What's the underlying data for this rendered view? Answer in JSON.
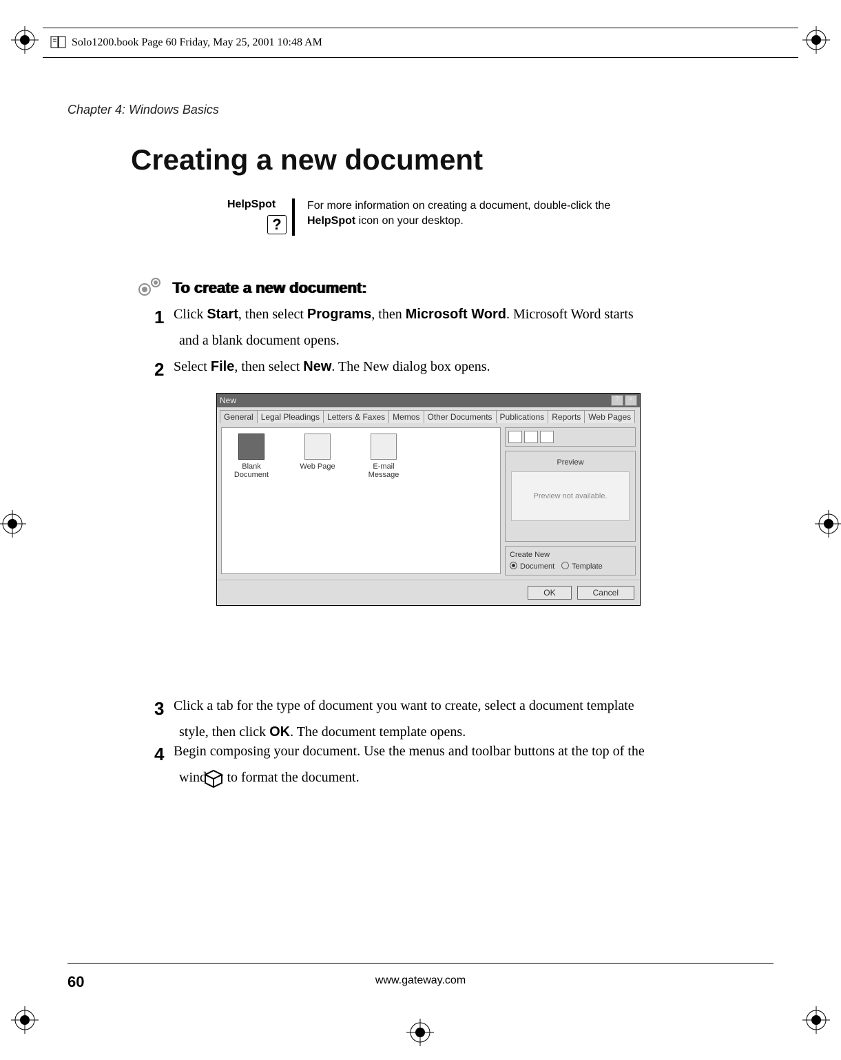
{
  "header_line": "Solo1200.book  Page 60  Friday, May 25, 2001  10:48 AM",
  "chapter": "Chapter 4: Windows Basics",
  "heading": "Creating a new document",
  "helpspot": {
    "label": "HelpSpot",
    "text_before": "For more information on creating a document, double-click the ",
    "bold": "HelpSpot",
    "text_after": " icon on your desktop."
  },
  "subheading": "To create a new document:",
  "steps": [
    {
      "num": "1",
      "parts": [
        {
          "t": "Click ",
          "b": false
        },
        {
          "t": "Start",
          "b": true
        },
        {
          "t": ", then select ",
          "b": false
        },
        {
          "t": "Programs",
          "b": true
        },
        {
          "t": ", then ",
          "b": false
        },
        {
          "t": "Microsoft Word",
          "b": true
        },
        {
          "t": ". Microsoft Word starts and a blank document opens.",
          "b": false
        }
      ]
    },
    {
      "num": "2",
      "parts": [
        {
          "t": "Select ",
          "b": false
        },
        {
          "t": "File",
          "b": true
        },
        {
          "t": ", then select ",
          "b": false
        },
        {
          "t": "New",
          "b": true
        },
        {
          "t": ". The New dialog box opens.",
          "b": false
        }
      ]
    },
    {
      "num": "3",
      "parts": [
        {
          "t": "Click a tab for the type of document you want to create, select a document template style, then click ",
          "b": false
        },
        {
          "t": "OK",
          "b": true
        },
        {
          "t": ". The document template opens.",
          "b": false
        }
      ]
    },
    {
      "num": "4",
      "parts": [
        {
          "t": "Begin composing your document. Use the menus and toolbar buttons at the top of the window to format the document.",
          "b": false
        }
      ]
    }
  ],
  "dialog": {
    "title": "New",
    "tabs": [
      "General",
      "Legal Pleadings",
      "Letters & Faxes",
      "Memos",
      "Other Documents",
      "Publications",
      "Reports",
      "Web Pages"
    ],
    "templates": [
      {
        "name": "Blank Document"
      },
      {
        "name": "Web Page"
      },
      {
        "name": "E-mail Message"
      }
    ],
    "preview_label": "Preview",
    "preview_text": "Preview not available.",
    "create_label": "Create New",
    "radios": [
      {
        "label": "Document",
        "sel": true
      },
      {
        "label": "Template",
        "sel": false
      }
    ],
    "ok": "OK",
    "cancel": "Cancel"
  },
  "page_number": "60",
  "footer_url": "www.gateway.com"
}
